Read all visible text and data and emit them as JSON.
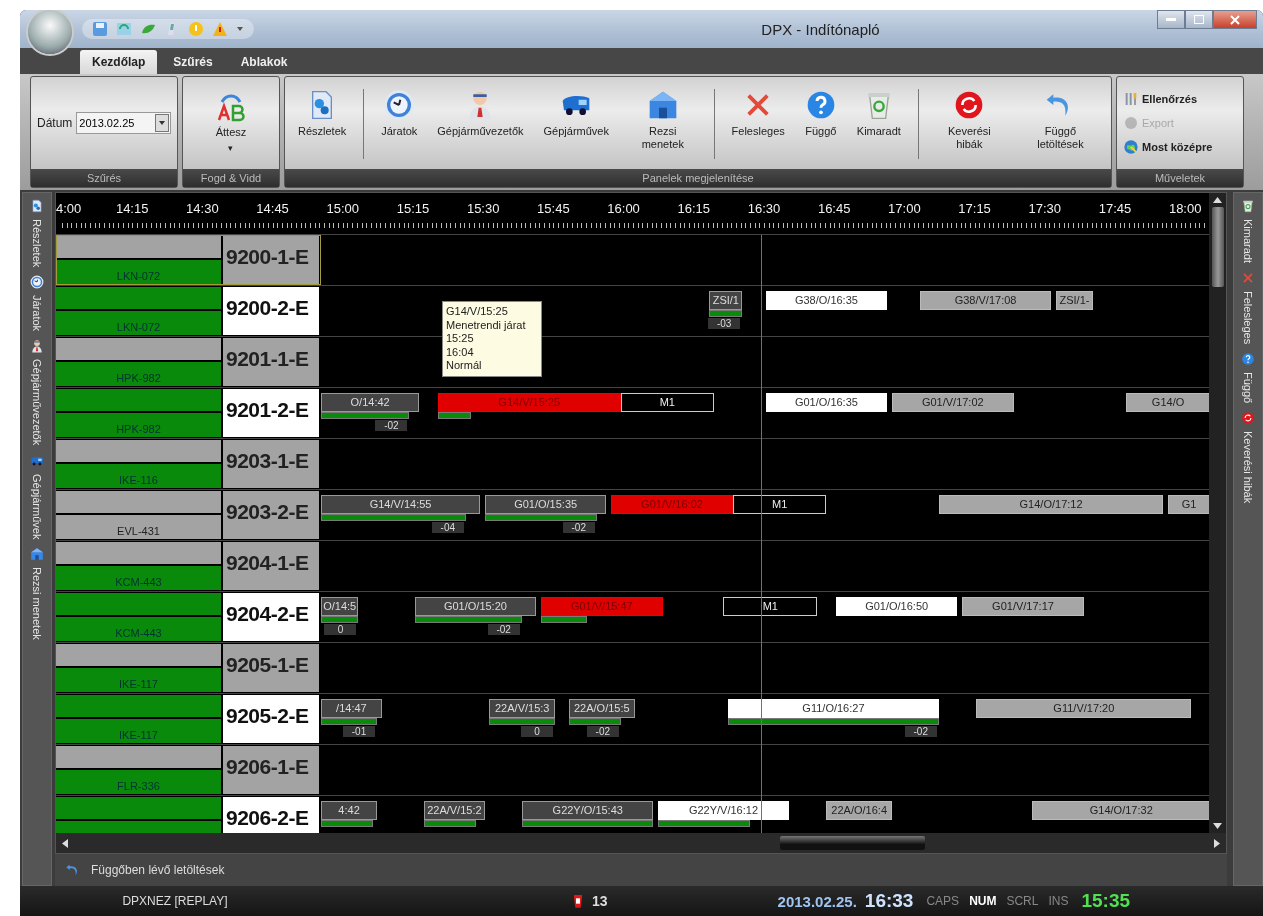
{
  "window": {
    "title": "DPX - Indítónapló"
  },
  "ribbon_tabs": [
    {
      "label": "Kezdőlap",
      "selected": true
    },
    {
      "label": "Szűrés",
      "selected": false
    },
    {
      "label": "Ablakok",
      "selected": false
    }
  ],
  "filter_group": {
    "label": "Dátum",
    "value": "2013.02.25",
    "caption": "Szűrés"
  },
  "drag_group": {
    "button": "Áttesz",
    "caret": "▾",
    "caption": "Fogd & Vidd"
  },
  "panels_group": {
    "caption": "Panelek megjelenítése",
    "sections": [
      [
        {
          "label": "Részletek"
        }
      ],
      [
        {
          "label": "Járatok"
        },
        {
          "label": "Gépjárművezetők"
        },
        {
          "label": "Gépjárművek"
        },
        {
          "label": "Rezsi menetek"
        }
      ],
      [
        {
          "label": "Felesleges"
        },
        {
          "label": "Függő"
        },
        {
          "label": "Kimaradt"
        }
      ],
      [
        {
          "label": "Keverési hibák"
        },
        {
          "label": "Függő letöltések"
        }
      ]
    ]
  },
  "actions_group": {
    "caption": "Műveletek",
    "items": [
      {
        "label": "Ellenőrzés",
        "disabled": false
      },
      {
        "label": "Export",
        "disabled": true
      },
      {
        "label": "Most középre",
        "disabled": false
      }
    ]
  },
  "left_sidebar": [
    "Részletek",
    "Járatok",
    "Gépjárművezetők",
    "Gépjárművek",
    "Rezsi menetek"
  ],
  "right_sidebar": [
    "Kimaradt",
    "Felesleges",
    "Függő",
    "Keverési hibák"
  ],
  "time_ruler": [
    "4:00",
    "14:15",
    "14:30",
    "14:45",
    "15:00",
    "15:15",
    "15:30",
    "15:45",
    "16:00",
    "16:15",
    "16:30",
    "16:45",
    "17:00",
    "17:15",
    "17:30",
    "17:45",
    "18:00"
  ],
  "rows": [
    {
      "code": "9200-1-E",
      "code_active": false,
      "top_ok": false,
      "plate": "LKN-072",
      "plate_ok": true,
      "selected": true,
      "trips": []
    },
    {
      "code": "9200-2-E",
      "code_active": true,
      "top_ok": true,
      "plate": "LKN-072",
      "plate_ok": true,
      "selected": false,
      "trips": [
        {
          "kind": "dark",
          "label": "ZSI/1",
          "level": 1,
          "delay": "-03"
        },
        {
          "kind": "white",
          "label": "G38/O/16:35"
        },
        {
          "kind": "grey",
          "label": "G38/V/17:08"
        },
        {
          "kind": "grey",
          "label": "ZSI/1-"
        }
      ]
    },
    {
      "code": "9201-1-E",
      "code_active": false,
      "top_ok": false,
      "plate": "HPK-982",
      "plate_ok": true,
      "selected": false,
      "trips": []
    },
    {
      "code": "9201-2-E",
      "code_active": true,
      "top_ok": true,
      "plate": "HPK-982",
      "plate_ok": true,
      "selected": false,
      "trips": [
        {
          "kind": "dark",
          "label": "O/14:42",
          "level": 0.9,
          "delay": "-02"
        },
        {
          "kind": "red",
          "label": "G14/V/15:25",
          "level": 0.18
        },
        {
          "kind": "outline",
          "label": "M1"
        },
        {
          "kind": "white",
          "label": "G01/O/16:35"
        },
        {
          "kind": "grey",
          "label": "G01/V/17:02"
        },
        {
          "kind": "grey",
          "label": "G14/O"
        }
      ]
    },
    {
      "code": "9203-1-E",
      "code_active": false,
      "top_ok": false,
      "plate": "IKE-116",
      "plate_ok": true,
      "selected": false,
      "trips": []
    },
    {
      "code": "9203-2-E",
      "code_active": false,
      "top_ok": false,
      "plate": "EVL-431",
      "plate_ok": false,
      "selected": false,
      "trips": [
        {
          "kind": "dark",
          "label": "G14/V/14:55",
          "level": 0.91,
          "delay": "-04"
        },
        {
          "kind": "dark",
          "label": "G01/O/15:35",
          "level": 0.92,
          "delay": "-02"
        },
        {
          "kind": "red",
          "label": "G01/V/16:02"
        },
        {
          "kind": "outline",
          "label": "M1"
        },
        {
          "kind": "grey",
          "label": "G14/O/17:12"
        },
        {
          "kind": "grey",
          "label": "G1"
        }
      ]
    },
    {
      "code": "9204-1-E",
      "code_active": false,
      "top_ok": false,
      "plate": "KCM-443",
      "plate_ok": true,
      "selected": false,
      "trips": []
    },
    {
      "code": "9204-2-E",
      "code_active": true,
      "top_ok": true,
      "plate": "KCM-443",
      "plate_ok": true,
      "selected": false,
      "trips": [
        {
          "kind": "dark",
          "label": "O/14:5",
          "level": 1,
          "delay": "0"
        },
        {
          "kind": "dark",
          "label": "G01/O/15:20",
          "level": 0.88,
          "delay": "-02"
        },
        {
          "kind": "red",
          "label": "G01/V/15:47",
          "level": 0.38
        },
        {
          "kind": "outline",
          "label": "M1"
        },
        {
          "kind": "white",
          "label": "G01/O/16:50"
        },
        {
          "kind": "grey",
          "label": "G01/V/17:17"
        }
      ]
    },
    {
      "code": "9205-1-E",
      "code_active": false,
      "top_ok": false,
      "plate": "IKE-117",
      "plate_ok": true,
      "selected": false,
      "trips": []
    },
    {
      "code": "9205-2-E",
      "code_active": true,
      "top_ok": true,
      "plate": "IKE-117",
      "plate_ok": true,
      "selected": false,
      "trips": [
        {
          "kind": "dark",
          "label": "/14:47",
          "level": 0.92,
          "delay": "-01"
        },
        {
          "kind": "dark",
          "label": "22A/V/15:3",
          "level": 1,
          "delay": "0"
        },
        {
          "kind": "dark",
          "label": "22A/O/15:5",
          "level": 0.79,
          "delay": "-02"
        },
        {
          "kind": "white",
          "label": "G11/O/16:27",
          "level": 1,
          "delay": "-02"
        },
        {
          "kind": "grey",
          "label": "G11/V/17:20"
        }
      ]
    },
    {
      "code": "9206-1-E",
      "code_active": false,
      "top_ok": false,
      "plate": "FLR-336",
      "plate_ok": true,
      "selected": false,
      "trips": []
    },
    {
      "code": "9206-2-E",
      "code_active": true,
      "top_ok": true,
      "plate_ok": true,
      "selected": false,
      "trips": [
        {
          "kind": "dark",
          "label": "4:42",
          "level": 0.92
        },
        {
          "kind": "dark",
          "label": "22A/V/15:2",
          "level": 0.85
        },
        {
          "kind": "dark",
          "label": "G22Y/O/15:43",
          "level": 1
        },
        {
          "kind": "white",
          "label": "G22Y/V/16:12",
          "level": 0.7
        },
        {
          "kind": "grey",
          "label": "22A/O/16:4"
        },
        {
          "kind": "grey",
          "label": "G14/O/17:32"
        }
      ]
    }
  ],
  "tooltip": [
    "G14/V/15:25",
    "Menetrendi járat",
    "15:25",
    "16:04",
    "Normál"
  ],
  "pending_bar": "Függőben lévő letöltések",
  "status_bar": {
    "user": "DPXNEZ [REPLAY]",
    "alerts": "13",
    "date": "2013.02.25.",
    "clock": "16:33",
    "indicators": [
      {
        "label": "CAPS",
        "on": false
      },
      {
        "label": "NUM",
        "on": true
      },
      {
        "label": "SCRL",
        "on": false
      },
      {
        "label": "INS",
        "on": false
      }
    ],
    "replay_time": "15:35"
  }
}
